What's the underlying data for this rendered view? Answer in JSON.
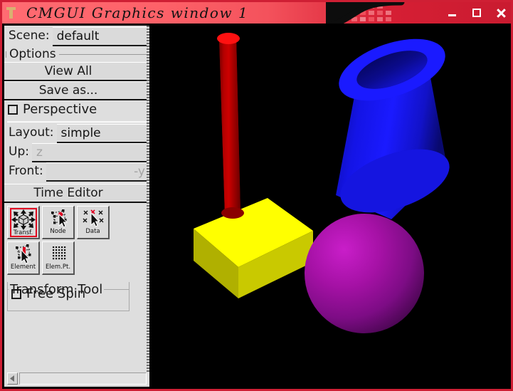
{
  "window": {
    "title": "CMGUI Graphics window 1",
    "icon": "app-icon",
    "titlebar_color": "#f4525c",
    "accent_border": "#cf1f34",
    "controls": [
      {
        "name": "minimize",
        "glyph": "minimize-icon"
      },
      {
        "name": "maximize",
        "glyph": "maximize-icon"
      },
      {
        "name": "close",
        "glyph": "close-icon"
      }
    ]
  },
  "sidebar": {
    "scene": {
      "label": "Scene:",
      "value": "default"
    },
    "options_group": "Options",
    "view_all_button": "View All",
    "save_as_button": "Save as...",
    "perspective": {
      "label": "Perspective",
      "checked": false
    },
    "layout": {
      "label": "Layout:",
      "value": "simple"
    },
    "up": {
      "label": "Up:",
      "value": "z"
    },
    "front": {
      "label": "Front:",
      "value": "-y"
    },
    "time_editor_button": "Time Editor",
    "tools": [
      {
        "name": "transform-tool",
        "label": "Transf.",
        "icon": "transform-icon",
        "selected": true
      },
      {
        "name": "node-tool",
        "label": "Node",
        "icon": "node-cursor-icon",
        "selected": false
      },
      {
        "name": "data-tool",
        "label": "Data",
        "icon": "data-cursor-icon",
        "selected": false
      },
      {
        "name": "element-tool",
        "label": "Element",
        "icon": "element-cursor-icon",
        "selected": false
      },
      {
        "name": "element-point-tool",
        "label": "Elem.Pt.",
        "icon": "element-point-grid-icon",
        "selected": false
      }
    ],
    "transform_group": "Transform Tool",
    "free_spin": {
      "label": "Free Spin",
      "checked": false
    }
  },
  "canvas": {
    "background": "#000000",
    "objects": [
      {
        "name": "cylinder",
        "color": "#c00000",
        "highlight": "#ff0000"
      },
      {
        "name": "box",
        "color": "#ffff00",
        "shade": "#b3b300"
      },
      {
        "name": "tube",
        "color": "#1414ff",
        "shade": "#0a0aa0"
      },
      {
        "name": "sphere",
        "color": "#a511a5",
        "shade": "#6b0a73"
      }
    ]
  }
}
